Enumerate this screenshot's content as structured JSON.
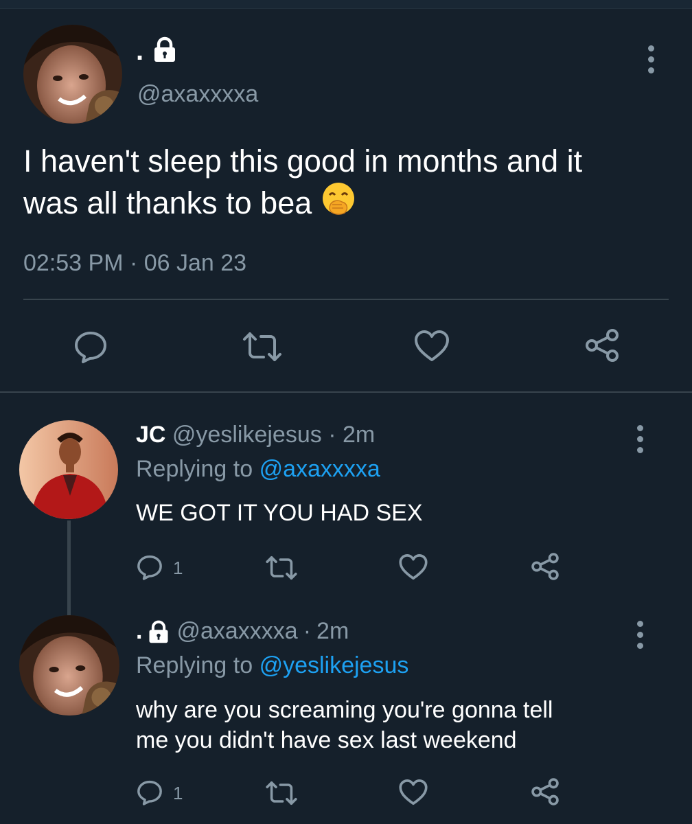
{
  "colors": {
    "background": "#15202b",
    "text": "#ffffff",
    "muted": "#8899a6",
    "link": "#1da1f2",
    "divider": "#38444d"
  },
  "main_tweet": {
    "display_name": ".",
    "locked_icon": "lock-icon",
    "handle": "@axaxxxxa",
    "text_line1": "I haven't sleep this good in months and it",
    "text_line2": "was all thanks to bea",
    "emoji": "hand-over-mouth-emoji",
    "timestamp": "02:53 PM · 06 Jan 23",
    "actions": [
      "reply-icon",
      "retweet-icon",
      "like-icon",
      "share-icon"
    ]
  },
  "replies": [
    {
      "display_name": "JC",
      "handle": "@yeslikejesus",
      "sep": "·",
      "time": "2m",
      "replying_prefix": "Replying to",
      "replying_to": "@axaxxxxa",
      "text_line1": "WE GOT IT YOU HAD SEX",
      "text_line2": "",
      "reply_count": "1"
    },
    {
      "display_name": ".",
      "locked_icon": "lock-icon",
      "handle": "@axaxxxxa",
      "sep": "·",
      "time": "2m",
      "replying_prefix": "Replying to",
      "replying_to": "@yeslikejesus",
      "text_line1": "why are you screaming you're gonna tell",
      "text_line2": "me you didn't have sex last weekend",
      "reply_count": "1"
    }
  ]
}
